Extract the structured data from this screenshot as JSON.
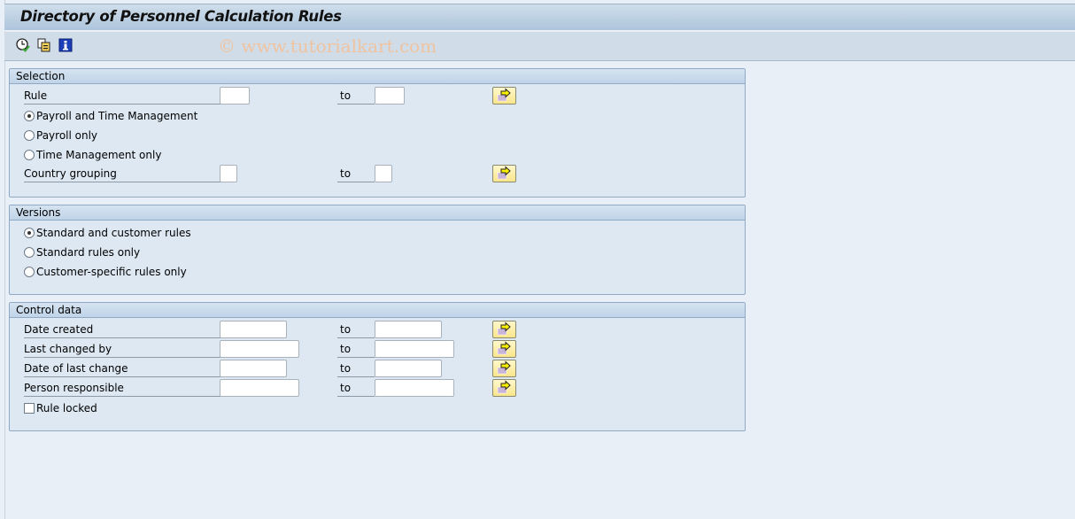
{
  "window": {
    "title": "Directory of Personnel Calculation Rules"
  },
  "toolbar": {
    "icons": [
      "execute-icon",
      "get-variant-icon",
      "program-documentation-icon"
    ],
    "watermark": "© www.tutorialkart.com"
  },
  "selection": {
    "header": "Selection",
    "rule_label": "Rule",
    "rule_from": "",
    "rule_to": "",
    "to_label": "to",
    "options": [
      {
        "label": "Payroll and Time Management",
        "checked": true
      },
      {
        "label": "Payroll only",
        "checked": false
      },
      {
        "label": "Time Management only",
        "checked": false
      }
    ],
    "country_label": "Country grouping",
    "country_from": "",
    "country_to": ""
  },
  "versions": {
    "header": "Versions",
    "options": [
      {
        "label": "Standard and customer rules",
        "checked": true
      },
      {
        "label": "Standard rules only",
        "checked": false
      },
      {
        "label": "Customer-specific rules only",
        "checked": false
      }
    ]
  },
  "control": {
    "header": "Control data",
    "to_label": "to",
    "fields": [
      {
        "label": "Date created",
        "from": "",
        "to": ""
      },
      {
        "label": "Last changed by",
        "from": "",
        "to": ""
      },
      {
        "label": "Date of last change",
        "from": "",
        "to": ""
      },
      {
        "label": "Person responsible",
        "from": "",
        "to": ""
      }
    ],
    "rule_locked_label": "Rule locked",
    "rule_locked": false
  }
}
